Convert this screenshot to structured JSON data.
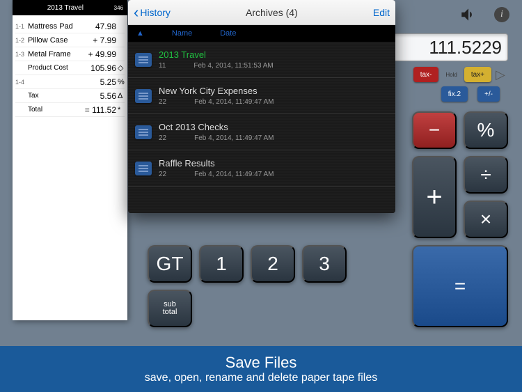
{
  "tape": {
    "title": "2013 Travel",
    "count": "346",
    "rows": [
      {
        "idx": "1-1",
        "label": "Mattress Pad",
        "val": "47.98",
        "sym": ""
      },
      {
        "idx": "1-2",
        "label": "Pillow Case",
        "val": "+ 7.99",
        "sym": ""
      },
      {
        "idx": "1-3",
        "label": "Metal Frame",
        "val": "+ 49.99",
        "sym": ""
      },
      {
        "idx": "",
        "label": "Product Cost",
        "val": "105.96",
        "sym": "◇"
      },
      {
        "idx": "1-4",
        "label": "",
        "val": "5.25",
        "sym": "%"
      },
      {
        "idx": "",
        "label": "Tax",
        "val": "5.56",
        "sym": "Δ"
      },
      {
        "idx": "",
        "label": "Total",
        "val": "= 111.52",
        "sym": "*"
      }
    ]
  },
  "display": "111.5229",
  "fn": {
    "tax_minus": "tax-",
    "hold": "Hold",
    "tax_plus": "tax+",
    "fix2": "fix.2",
    "plusminus": "+/-"
  },
  "keys": {
    "gt": "GT",
    "k1": "1",
    "k2": "2",
    "k3": "3",
    "minus": "−",
    "percent": "%",
    "divide": "÷",
    "plus": "+",
    "times": "×",
    "sub1": "sub",
    "sub2": "total",
    "equals": "="
  },
  "modal": {
    "back": "History",
    "title": "Archives (4)",
    "edit": "Edit",
    "header": {
      "sort": "▲",
      "name": "Name",
      "date": "Date"
    },
    "rows": [
      {
        "name": "2013 Travel",
        "active": true,
        "count": "11",
        "date": "Feb 4, 2014, 11:51:53 AM"
      },
      {
        "name": "New York City Expenses",
        "active": false,
        "count": "22",
        "date": "Feb 4, 2014, 11:49:47 AM"
      },
      {
        "name": "Oct 2013 Checks",
        "active": false,
        "count": "22",
        "date": "Feb 4, 2014, 11:49:47 AM"
      },
      {
        "name": "Raffle Results",
        "active": false,
        "count": "22",
        "date": "Feb 4, 2014, 11:49:47 AM"
      }
    ]
  },
  "banner": {
    "title": "Save Files",
    "sub": "save, open, rename and delete paper tape files"
  }
}
